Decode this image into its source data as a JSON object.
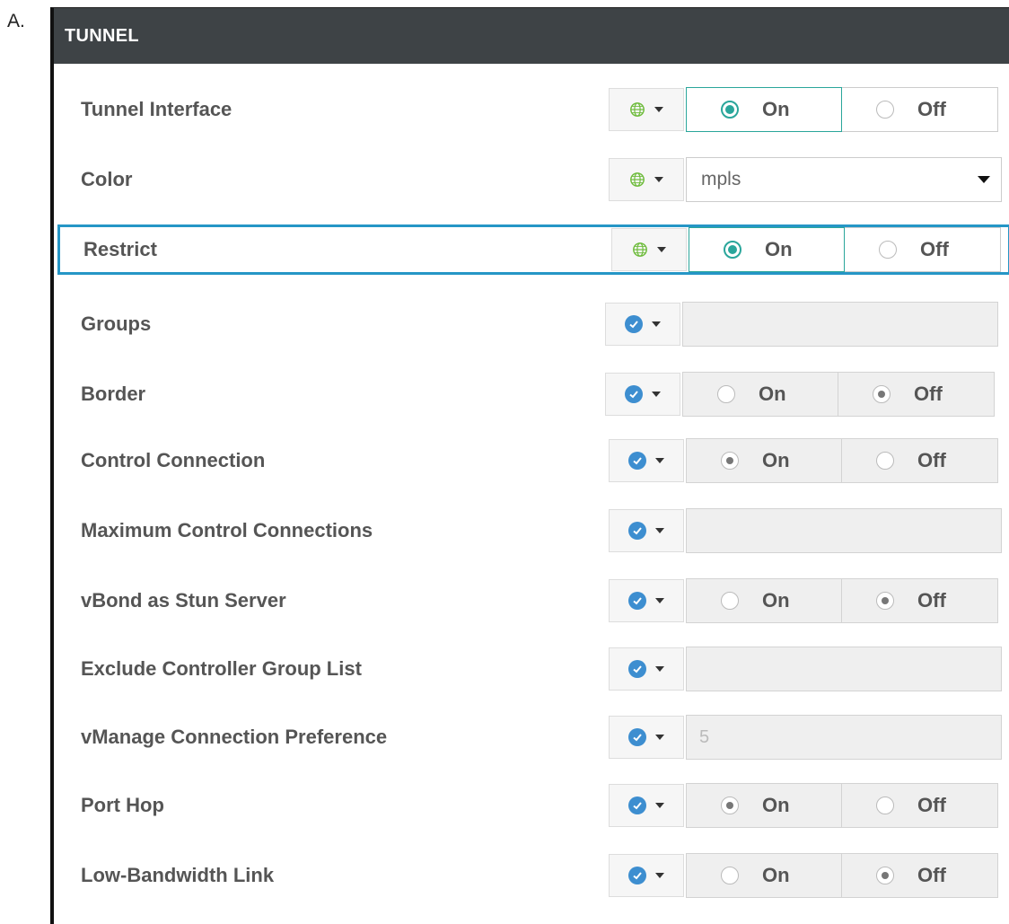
{
  "option_letter": "A.",
  "panel_title": "TUNNEL",
  "rows": [
    {
      "label": "Tunnel Interface",
      "scope_icon": "globe-icon",
      "control": "toggle",
      "on_label": "On",
      "off_label": "Off",
      "selected": "On"
    },
    {
      "label": "Color",
      "scope_icon": "globe-icon",
      "control": "select",
      "value": "mpls"
    },
    {
      "label": "Restrict",
      "scope_icon": "globe-icon",
      "control": "toggle",
      "on_label": "On",
      "off_label": "Off",
      "selected": "On",
      "highlighted": true
    },
    {
      "label": "Groups",
      "scope_icon": "check-circle-icon",
      "control": "text",
      "value": ""
    },
    {
      "label": "Border",
      "scope_icon": "check-circle-icon",
      "control": "toggle",
      "on_label": "On",
      "off_label": "Off",
      "selected": "Off"
    },
    {
      "label": "Control Connection",
      "scope_icon": "check-circle-icon",
      "control": "toggle",
      "on_label": "On",
      "off_label": "Off",
      "selected": "On"
    },
    {
      "label": "Maximum Control Connections",
      "scope_icon": "check-circle-icon",
      "control": "text",
      "value": ""
    },
    {
      "label": "vBond as Stun Server",
      "scope_icon": "check-circle-icon",
      "control": "toggle",
      "on_label": "On",
      "off_label": "Off",
      "selected": "Off"
    },
    {
      "label": "Exclude Controller Group List",
      "scope_icon": "check-circle-icon",
      "control": "text",
      "value": ""
    },
    {
      "label": "vManage Connection Preference",
      "scope_icon": "check-circle-icon",
      "control": "text",
      "value": "5"
    },
    {
      "label": "Port Hop",
      "scope_icon": "check-circle-icon",
      "control": "toggle",
      "on_label": "On",
      "off_label": "Off",
      "selected": "On"
    },
    {
      "label": "Low-Bandwidth Link",
      "scope_icon": "check-circle-icon",
      "control": "toggle",
      "on_label": "On",
      "off_label": "Off",
      "selected": "Off"
    }
  ],
  "colors": {
    "header_bg": "#3e4346",
    "accent_teal": "#2aa69b",
    "highlight_blue": "#2596c6",
    "check_blue": "#3d8ed0"
  }
}
